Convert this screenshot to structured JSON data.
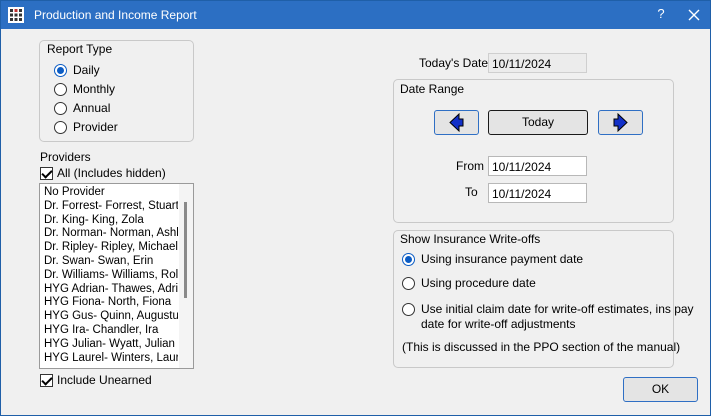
{
  "window": {
    "title": "Production and Income Report",
    "help_label": "?"
  },
  "report_type": {
    "title": "Report Type",
    "options": [
      {
        "label": "Daily",
        "checked": true
      },
      {
        "label": "Monthly",
        "checked": false
      },
      {
        "label": "Annual",
        "checked": false
      },
      {
        "label": "Provider",
        "checked": false
      }
    ]
  },
  "providers": {
    "title": "Providers",
    "all_label": "All (Includes hidden)",
    "all_checked": true,
    "items": [
      "No Provider",
      "Dr. Forrest- Forrest, Stuart",
      "Dr. King- King, Zola",
      "Dr. Norman- Norman, Ashle",
      "Dr. Ripley- Ripley, Michael",
      "Dr. Swan- Swan, Erin",
      "Dr. Williams- Williams, Rol",
      "HYG Adrian- Thawes, Adria",
      "HYG Fiona- North, Fiona",
      "HYG Gus- Quinn, Augustu",
      "HYG Ira- Chandler, Ira",
      "HYG Julian- Wyatt, Julian",
      "HYG Laurel- Winters, Laure"
    ],
    "include_unearned_label": "Include Unearned",
    "include_unearned_checked": true
  },
  "today": {
    "label": "Today's Date",
    "value": "10/11/2024"
  },
  "date_range": {
    "title": "Date Range",
    "prev_icon": "left-arrow-icon",
    "today_button": "Today",
    "next_icon": "right-arrow-icon",
    "from_label": "From",
    "from_value": "10/11/2024",
    "to_label": "To",
    "to_value": "10/11/2024"
  },
  "writeoffs": {
    "title": "Show Insurance Write-offs",
    "options": [
      {
        "label": "Using insurance payment date",
        "checked": true
      },
      {
        "label": "Using procedure date",
        "checked": false
      },
      {
        "label": "Use initial claim date for write-off estimates, ins pay",
        "label2": "date for write-off adjustments",
        "checked": false
      }
    ],
    "note": "(This is discussed in the PPO section of the manual)"
  },
  "ok_button": "OK",
  "colors": {
    "titlebar": "#2c6fc3",
    "accent": "#0b5cc4",
    "arrow_fill": "#1230c8"
  }
}
